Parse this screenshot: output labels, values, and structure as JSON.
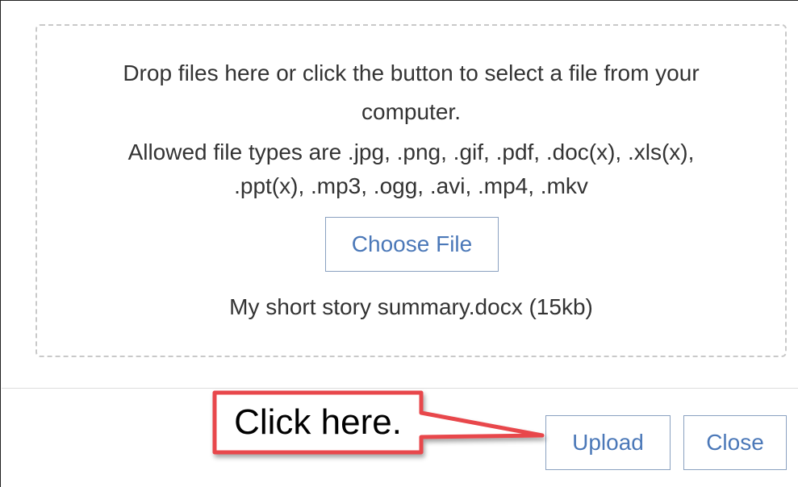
{
  "dropzone": {
    "line1": "Drop files here or click the button to select a file from your",
    "line2": "computer.",
    "line3": "Allowed file types are .jpg, .png, .gif, .pdf, .doc(x), .xls(x),",
    "line4": ".ppt(x), .mp3, .ogg, .avi, .mp4, .mkv",
    "choose_label": "Choose File",
    "selected_file": "My short story summary.docx (15kb)"
  },
  "footer": {
    "upload_label": "Upload",
    "close_label": "Close"
  },
  "annotation": {
    "callout_text": "Click here.",
    "callout_color": "#e8464b"
  },
  "colors": {
    "button_text": "#4b78b8",
    "button_border": "#8aa1c0",
    "dropzone_border": "#c9c9c9"
  }
}
